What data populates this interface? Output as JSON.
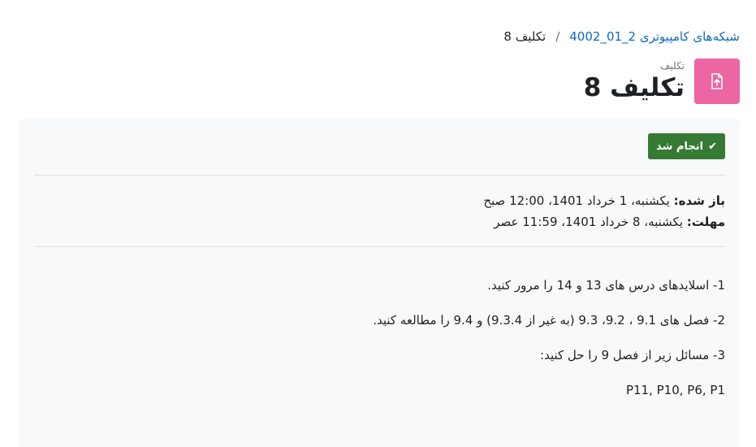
{
  "breadcrumb": {
    "course_link": "شبکه‌های کامپیوتری 2_01_4002",
    "separator": "/",
    "current": "تکلیف 8"
  },
  "header": {
    "pretitle": "تکلیف",
    "title": "تکلیف 8",
    "icon": "file-upload-icon",
    "icon_bg": "#eb66a2"
  },
  "completion": {
    "label": "انجام شد",
    "color": "#357a32"
  },
  "dates": {
    "opened_label": "باز شده:",
    "opened_value": "یکشنبه، 1 خرداد 1401، 12:00 صبح",
    "due_label": "مهلت:",
    "due_value": "یکشنبه، 8 خرداد 1401، 11:59 عصر"
  },
  "description": [
    "1- اسلایدهای درس های 13 و 14 را مرور کنید.",
    "2- فصل های 9.1 ، 9.2، 9.3 (به غیر از 9.3.4) و 9.4 را مطالعه کنید.",
    "3- مسائل زیر از فصل 9 را حل کنید:",
    "P11, P10, P6, P1"
  ],
  "colors": {
    "link": "#0f6cbf",
    "card_bg": "#f8f9fa"
  }
}
